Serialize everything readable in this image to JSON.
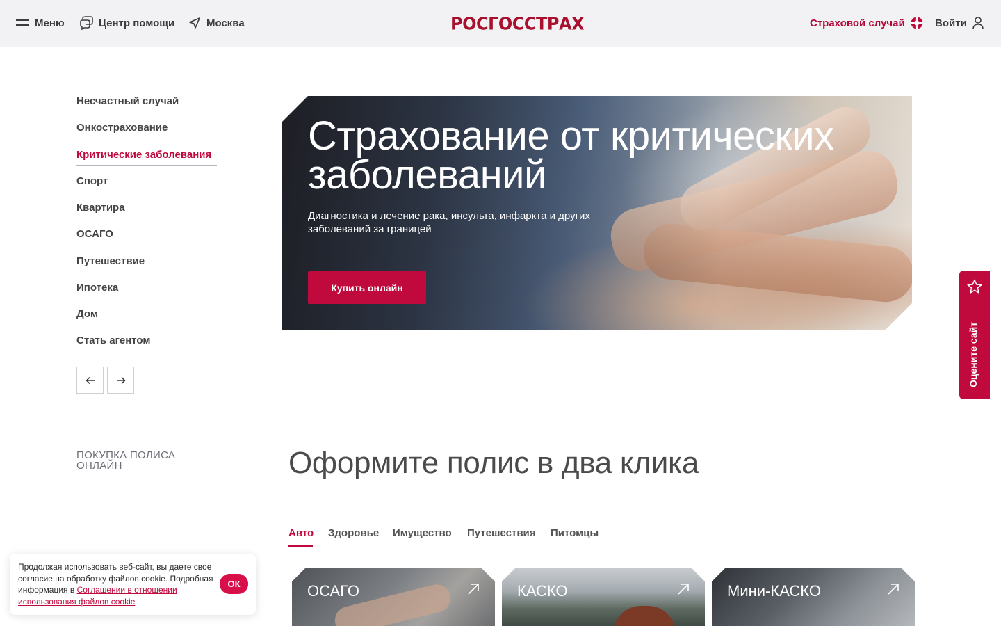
{
  "header": {
    "menu_label": "Меню",
    "help_label": "Центр помощи",
    "city_label": "Москва",
    "logo_text": "РОСГОССТРАХ",
    "claim_label": "Страховой случай",
    "login_label": "Войти"
  },
  "sidebar": {
    "items": [
      {
        "label": "Несчастный случай"
      },
      {
        "label": "Онкострахование"
      },
      {
        "label": "Критические заболевания"
      },
      {
        "label": "Спорт"
      },
      {
        "label": "Квартира"
      },
      {
        "label": "ОСАГО"
      },
      {
        "label": "Путешествие"
      },
      {
        "label": "Ипотека"
      },
      {
        "label": "Дом"
      },
      {
        "label": "Стать агентом"
      }
    ],
    "active_index": 2
  },
  "hero": {
    "title": "Страхование от критических заболеваний",
    "subtitle": "Диагностика и лечение рака, инсульта, инфаркта и других заболеваний за границей",
    "button_label": "Купить онлайн"
  },
  "rate_tab": {
    "label": "Оцените сайт"
  },
  "purchase": {
    "section_label": "ПОКУПКА ПОЛИСА ОНЛАЙН",
    "title": "Оформите полис в два клика",
    "tabs": [
      {
        "label": "Авто"
      },
      {
        "label": "Здоровье"
      },
      {
        "label": "Имущество"
      },
      {
        "label": "Путешествия"
      },
      {
        "label": "Питомцы"
      }
    ],
    "active_tab": "Авто",
    "cards": [
      {
        "name": "ОСАГО"
      },
      {
        "name": "КАСКО"
      },
      {
        "name": "Мини-КАСКО"
      }
    ]
  },
  "cookie": {
    "text": "Продолжая использовать веб-сайт, вы даете свое согласие на обработку файлов cookie. Подробная информация в",
    "link_text": "Соглашении в отношении использования файлов cookie",
    "ok_label": "ОК"
  },
  "colors": {
    "brand": "#c0093d",
    "logo": "#a8102e",
    "header_bg": "#f2f2f4"
  }
}
